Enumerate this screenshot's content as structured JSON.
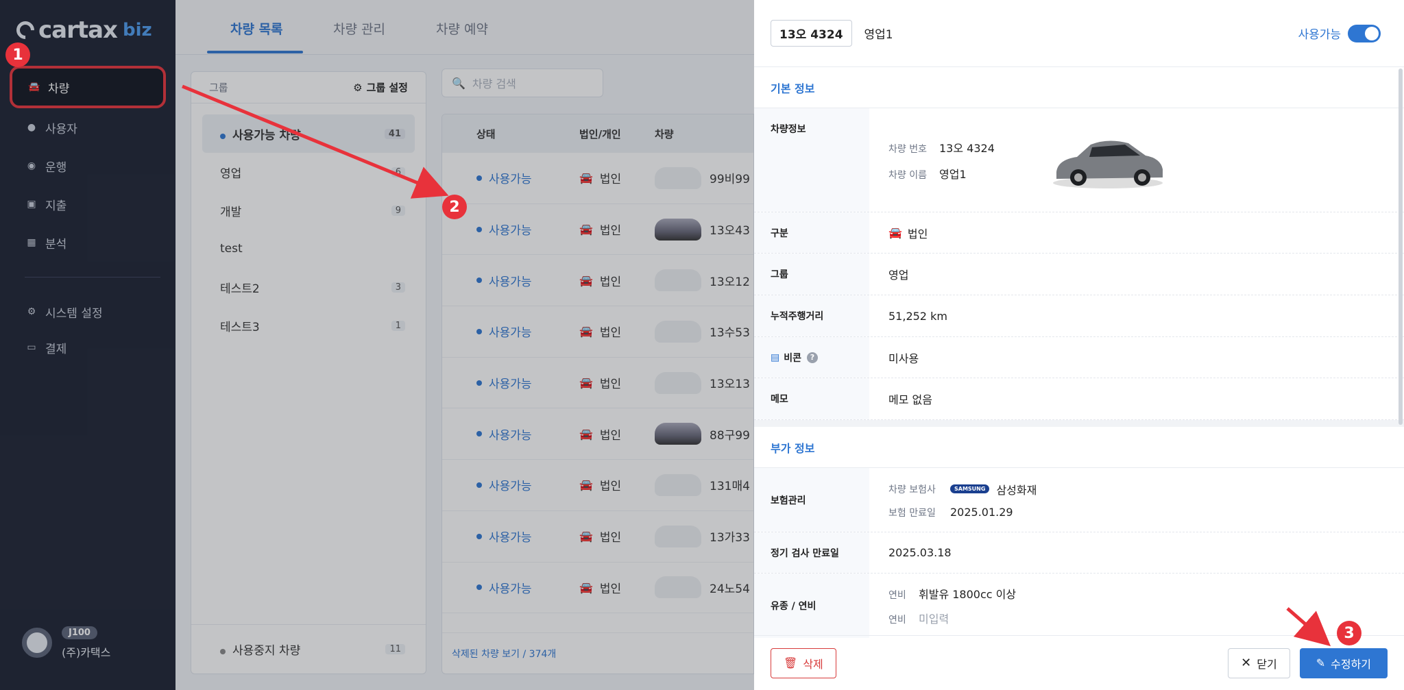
{
  "sidebar": {
    "logo": "cartax",
    "logo_sub": "biz",
    "items": [
      {
        "label": "차량",
        "icon": "car-icon"
      },
      {
        "label": "사용자",
        "icon": "user-icon"
      },
      {
        "label": "운행",
        "icon": "map-pin-icon"
      },
      {
        "label": "지출",
        "icon": "receipt-icon"
      },
      {
        "label": "분석",
        "icon": "chart-icon"
      },
      {
        "label": "시스템 설정",
        "icon": "gear-icon"
      },
      {
        "label": "결제",
        "icon": "card-icon"
      }
    ],
    "account": {
      "badge": "J100",
      "name": "(주)카택스"
    }
  },
  "tabs": [
    "차량 목록",
    "차량 관리",
    "차량 예약"
  ],
  "groups": {
    "header": "그룹",
    "settings": "그룹 설정",
    "items": [
      {
        "name": "사용가능 차량",
        "count": "41"
      },
      {
        "name": "영업",
        "count": "6"
      },
      {
        "name": "개발",
        "count": "9"
      },
      {
        "name": "test",
        "count": ""
      },
      {
        "name": "테스트2",
        "count": "3"
      },
      {
        "name": "테스트3",
        "count": "1"
      }
    ],
    "footer": {
      "name": "사용중지 차량",
      "count": "11"
    }
  },
  "search": {
    "placeholder": "차량 검색"
  },
  "table": {
    "headers": {
      "status": "상태",
      "corp": "법인/개인",
      "car": "차량"
    },
    "rows": [
      {
        "status": "사용가능",
        "corp": "법인",
        "number": "99비99"
      },
      {
        "status": "사용가능",
        "corp": "법인",
        "number": "13오43"
      },
      {
        "status": "사용가능",
        "corp": "법인",
        "number": "13오12"
      },
      {
        "status": "사용가능",
        "corp": "법인",
        "number": "13수53"
      },
      {
        "status": "사용가능",
        "corp": "법인",
        "number": "13오13"
      },
      {
        "status": "사용가능",
        "corp": "법인",
        "number": "88구99"
      },
      {
        "status": "사용가능",
        "corp": "법인",
        "number": "131매4"
      },
      {
        "status": "사용가능",
        "corp": "법인",
        "number": "13가33"
      },
      {
        "status": "사용가능",
        "corp": "법인",
        "number": "24노54"
      }
    ],
    "footer": "삭제된 차량 보기 / 374개"
  },
  "detail": {
    "plate": "13오 4324",
    "name": "영업1",
    "toggle_label": "사용가능",
    "basic_title": "기본 정보",
    "vehicle_info_label": "차량정보",
    "vehicle_number_label": "차량 번호",
    "vehicle_number": "13오 4324",
    "vehicle_name_label": "차량 이름",
    "vehicle_name": "영업1",
    "type_label": "구분",
    "type": "법인",
    "group_label": "그룹",
    "group": "영업",
    "mileage_label": "누적주행거리",
    "mileage": "51,252 km",
    "beacon_label": "비콘",
    "beacon": "미사용",
    "memo_label": "메모",
    "memo": "메모 없음",
    "extra_title": "부가 정보",
    "insurance_label": "보험관리",
    "insurer_label": "차량 보험사",
    "insurer_logo": "SAMSUNG",
    "insurer": "삼성화재",
    "insurance_exp_label": "보험 만료일",
    "insurance_exp": "2025.01.29",
    "inspection_label": "정기 검사 만료일",
    "inspection": "2025.03.18",
    "fuel_label": "유종 / 연비",
    "fuel_k1": "연비",
    "fuel_v1": "휘발유 1800cc 이상",
    "fuel_k2": "연비",
    "fuel_v2": "미입력",
    "delete": "삭제",
    "close": "닫기",
    "edit": "수정하기"
  },
  "markers": [
    "1",
    "2",
    "3"
  ],
  "colors": {
    "accent": "#2e76d2",
    "annotation": "#e8323b"
  }
}
